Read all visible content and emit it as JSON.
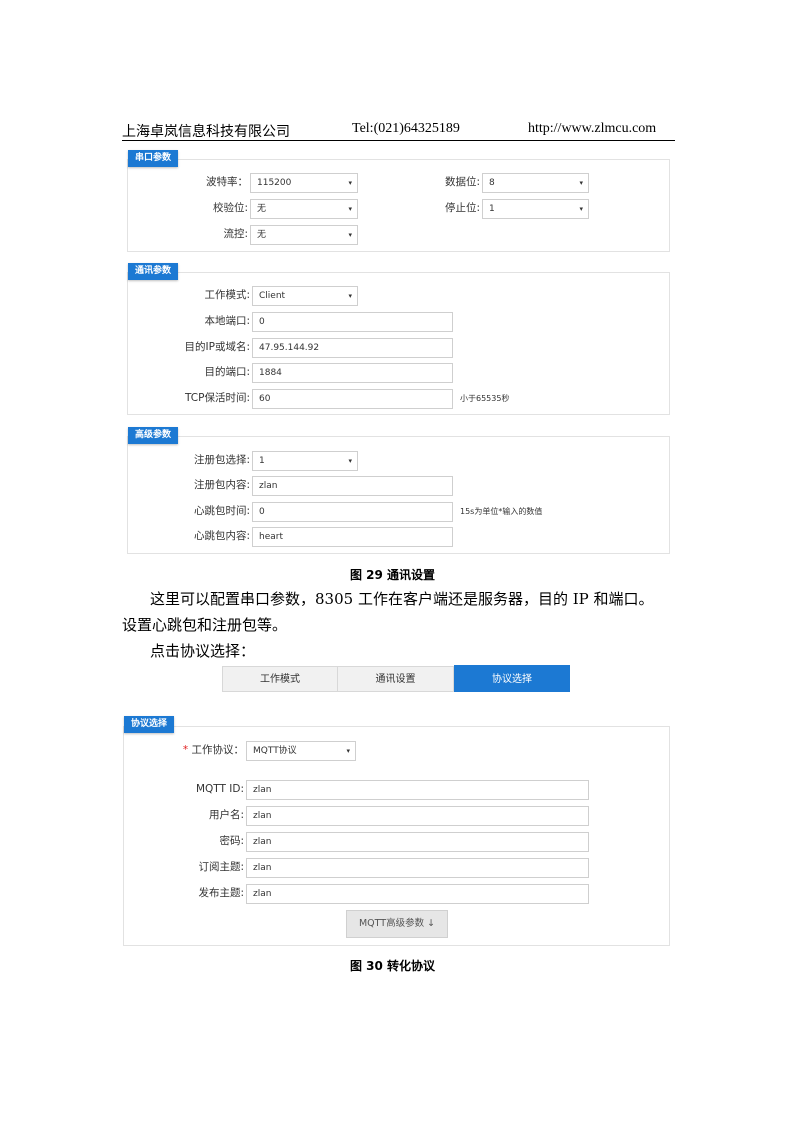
{
  "header": {
    "company": "上海卓岚信息科技有限公司",
    "tel": "Tel:(021)64325189",
    "url": "http://www.zlmcu.com"
  },
  "serial_panel": {
    "title": "串口参数",
    "baud_label": "波特率：",
    "baud_value": "115200",
    "databits_label": "数据位:",
    "databits_value": "8",
    "parity_label": "校验位:",
    "parity_value": "无",
    "stopbits_label": "停止位:",
    "stopbits_value": "1",
    "flow_label": "流控:",
    "flow_value": "无"
  },
  "comm_panel": {
    "title": "通讯参数",
    "mode_label": "工作模式:",
    "mode_value": "Client",
    "local_port_label": "本地端口:",
    "local_port_value": "0",
    "dest_ip_label": "目的IP或域名:",
    "dest_ip_value": "47.95.144.92",
    "dest_port_label": "目的端口:",
    "dest_port_value": "1884",
    "keepalive_label": "TCP保活时间:",
    "keepalive_value": "60",
    "keepalive_hint": "小于65535秒"
  },
  "adv_panel": {
    "title": "高级参数",
    "reg_select_label": "注册包选择:",
    "reg_select_value": "1",
    "reg_content_label": "注册包内容:",
    "reg_content_value": "zlan",
    "hb_time_label": "心跳包时间:",
    "hb_time_value": "0",
    "hb_time_hint": "15s为单位*输入的数值",
    "hb_content_label": "心跳包内容:",
    "hb_content_value": "heart"
  },
  "caption1": "图 29 通讯设置",
  "para1_line1": "这里可以配置串口参数，8305 工作在客户端还是服务器，目的 IP 和端口。",
  "para1_line2": "设置心跳包和注册包等。",
  "para2": "点击协议选择：",
  "tabs": [
    {
      "label": "工作模式"
    },
    {
      "label": "通讯设置"
    },
    {
      "label": "协议选择"
    }
  ],
  "protocol_panel": {
    "title": "协议选择",
    "required_mark": "*",
    "proto_label": "工作协议：",
    "proto_value": "MQTT协议",
    "mqtt_id_label": "MQTT ID:",
    "mqtt_id_value": "zlan",
    "user_label": "用户名:",
    "user_value": "zlan",
    "pwd_label": "密码:",
    "pwd_value": "zlan",
    "sub_label": "订阅主题:",
    "sub_value": "zlan",
    "pub_label": "发布主题:",
    "pub_value": "zlan",
    "adv_button": "MQTT高级参数 ↓"
  },
  "caption2": "图 30 转化协议",
  "icons": {
    "dropdown": "▾"
  }
}
